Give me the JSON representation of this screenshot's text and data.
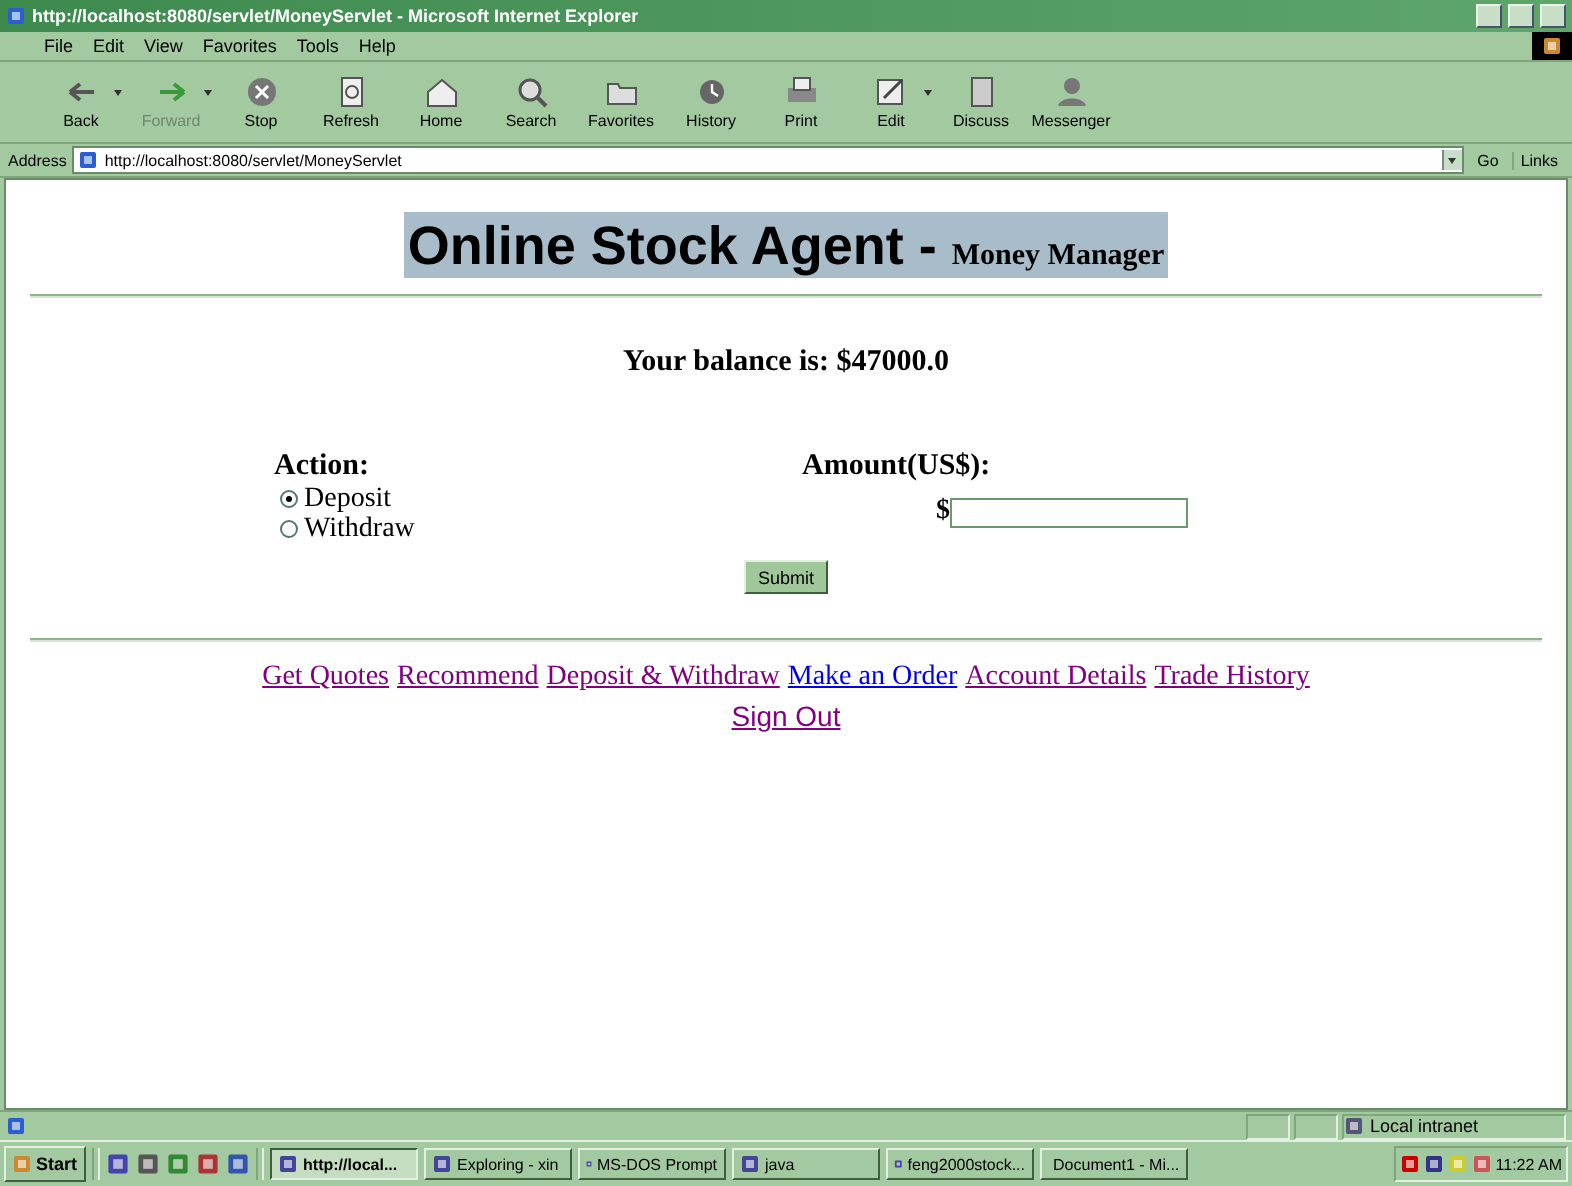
{
  "window": {
    "title": "http://localhost:8080/servlet/MoneyServlet - Microsoft Internet Explorer"
  },
  "menu": [
    "File",
    "Edit",
    "View",
    "Favorites",
    "Tools",
    "Help"
  ],
  "toolbar": [
    {
      "label": "Back",
      "kind": "back",
      "disabled": false,
      "dropdown": true
    },
    {
      "label": "Forward",
      "kind": "forward",
      "disabled": true,
      "dropdown": true
    },
    {
      "label": "Stop",
      "kind": "stop",
      "disabled": false,
      "dropdown": false
    },
    {
      "label": "Refresh",
      "kind": "refresh",
      "disabled": false,
      "dropdown": false
    },
    {
      "label": "Home",
      "kind": "home",
      "disabled": false,
      "dropdown": false
    },
    {
      "label": "Search",
      "kind": "search",
      "disabled": false,
      "dropdown": false
    },
    {
      "label": "Favorites",
      "kind": "favorites",
      "disabled": false,
      "dropdown": false
    },
    {
      "label": "History",
      "kind": "history",
      "disabled": false,
      "dropdown": false
    },
    {
      "label": "Print",
      "kind": "print",
      "disabled": false,
      "dropdown": false
    },
    {
      "label": "Edit",
      "kind": "edit",
      "disabled": false,
      "dropdown": true
    },
    {
      "label": "Discuss",
      "kind": "discuss",
      "disabled": false,
      "dropdown": false
    },
    {
      "label": "Messenger",
      "kind": "messenger",
      "disabled": false,
      "dropdown": false
    }
  ],
  "address": {
    "label": "Address",
    "value": "http://localhost:8080/servlet/MoneyServlet",
    "go": "Go",
    "links": "Links"
  },
  "page": {
    "heading": {
      "main": "Online Stock Agent - ",
      "sub": "Money Manager"
    },
    "balance": "Your balance is: $47000.0",
    "action": {
      "label": "Action:",
      "options": [
        {
          "label": "Deposit",
          "selected": true
        },
        {
          "label": "Withdraw",
          "selected": false
        }
      ]
    },
    "amount": {
      "label": "Amount(US$):",
      "prefix": "$"
    },
    "submit": "Submit",
    "links": [
      {
        "label": "Get Quotes",
        "visited": true
      },
      {
        "label": "Recommend",
        "visited": true
      },
      {
        "label": "Deposit & Withdraw",
        "visited": true
      },
      {
        "label": "Make an Order",
        "visited": false
      },
      {
        "label": "Account Details",
        "visited": true
      },
      {
        "label": "Trade History",
        "visited": true
      }
    ],
    "sign_out": {
      "label": "Sign Out",
      "visited": true
    }
  },
  "status_bar": {
    "zone": "Local intranet"
  },
  "taskbar": {
    "start": "Start",
    "tasks": [
      {
        "label": "http://local...",
        "selected": true
      },
      {
        "label": "Exploring - xin",
        "selected": false
      },
      {
        "label": "MS-DOS Prompt",
        "selected": false
      },
      {
        "label": "java",
        "selected": false
      },
      {
        "label": "feng2000stock...",
        "selected": false
      },
      {
        "label": "Document1 - Mi...",
        "selected": false
      }
    ],
    "clock": "11:22 AM"
  }
}
